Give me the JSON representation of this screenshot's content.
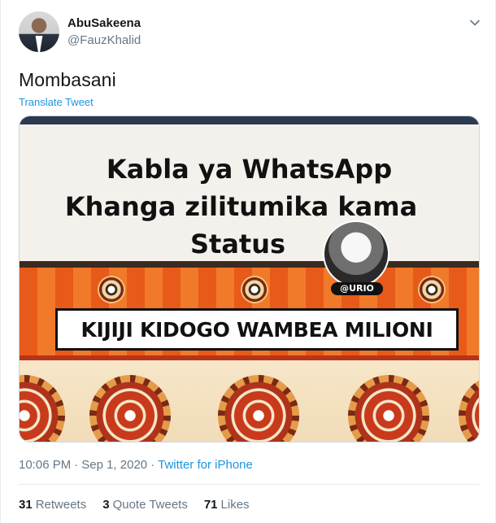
{
  "author": {
    "display_name": "AbuSakeena",
    "handle": "@FauzKhalid"
  },
  "tweet": {
    "text": "Mombasani",
    "translate_label": "Translate Tweet"
  },
  "media": {
    "headline_lines": [
      "Kabla ya WhatsApp",
      "Khanga zilitumika kama",
      "Status"
    ],
    "watermark": "@URIO",
    "label": "KIJIJI KIDOGO WAMBEA MILIONI"
  },
  "meta": {
    "time": "10:06 PM",
    "separator1": "·",
    "date": "Sep 1, 2020",
    "separator2": "·",
    "source": "Twitter for iPhone"
  },
  "stats": [
    {
      "count": "31",
      "label": "Retweets"
    },
    {
      "count": "3",
      "label": "Quote Tweets"
    },
    {
      "count": "71",
      "label": "Likes"
    }
  ],
  "icons": {
    "caret": "chevron-down-icon"
  },
  "colors": {
    "link": "#1b95e0",
    "muted": "#657786",
    "text": "#14171a"
  }
}
